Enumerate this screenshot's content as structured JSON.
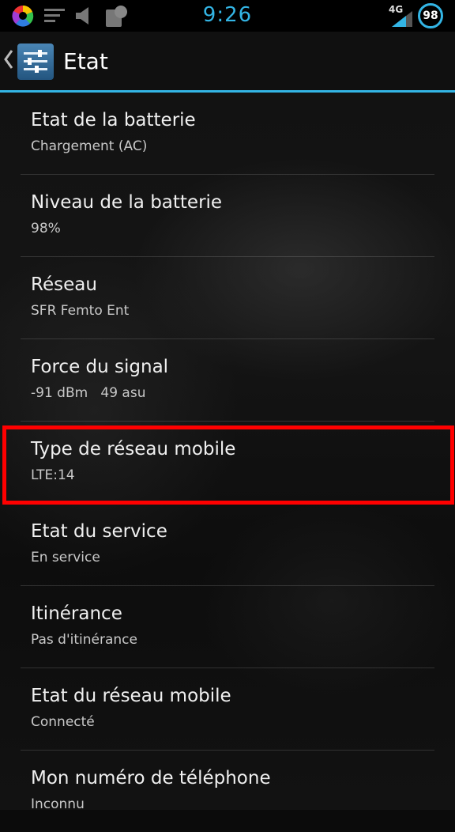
{
  "status_bar": {
    "time": "9:26",
    "network_type": "4G",
    "battery_level": "98",
    "accent_color": "#33b5e5",
    "icons": [
      "color-wheel-icon",
      "menu-lines-icon",
      "speaker-mute-icon",
      "notification-icon",
      "signal-strength-icon"
    ]
  },
  "action_bar": {
    "title": "Etat",
    "icon": "settings-sliders-icon"
  },
  "items": [
    {
      "title": "Etat de la batterie",
      "summary": "Chargement (AC)"
    },
    {
      "title": "Niveau de la batterie",
      "summary": "98%"
    },
    {
      "title": "Réseau",
      "summary": "SFR Femto Ent"
    },
    {
      "title": "Force du signal",
      "summary": "-91 dBm   49 asu"
    },
    {
      "title": "Type de réseau mobile",
      "summary": "LTE:14"
    },
    {
      "title": "Etat du service",
      "summary": "En service"
    },
    {
      "title": "Itinérance",
      "summary": "Pas d'itinérance"
    },
    {
      "title": "Etat du réseau mobile",
      "summary": "Connecté"
    },
    {
      "title": "Mon numéro de téléphone",
      "summary": "Inconnu"
    }
  ],
  "highlight_color": "#ff0000"
}
